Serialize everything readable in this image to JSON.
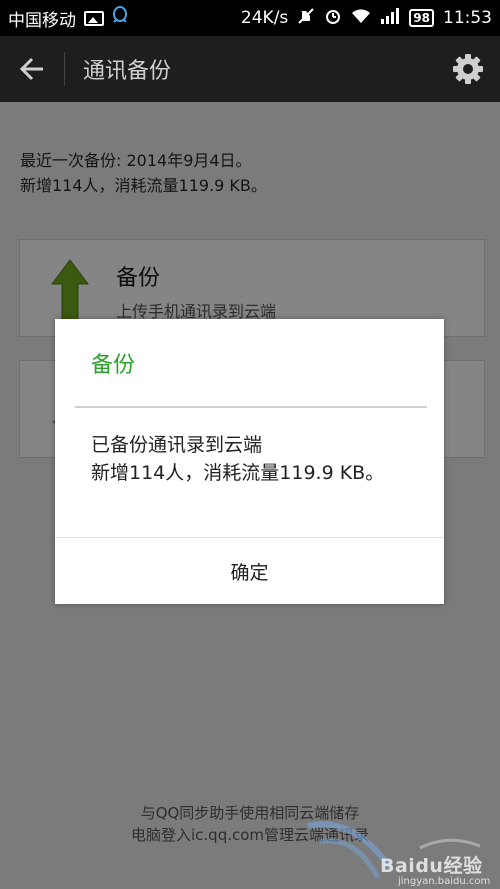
{
  "status_bar": {
    "carrier": "中国移动",
    "speed": "24K/s",
    "battery": "98",
    "time": "11:53"
  },
  "app_bar": {
    "title": "通讯备份"
  },
  "backup_info": {
    "last_backup": "最近一次备份: 2014年9月4日。",
    "summary": "新增114人，消耗流量119.9 KB。"
  },
  "backup_card": {
    "title": "备份",
    "subtitle": "上传手机通讯录到云端"
  },
  "footer": {
    "line1": "与QQ同步助手使用相同云端储存",
    "line2": "电脑登入ic.qq.com管理云端通讯录"
  },
  "dialog": {
    "title": "备份",
    "message": "已备份通讯录到云端\n新增114人，消耗流量119.9 KB。",
    "ok_label": "确定"
  },
  "watermark": {
    "brand": "Baidu经验",
    "url": "jingyan.baidu.com"
  },
  "colors": {
    "accent_green": "#2ea02e",
    "app_bar": "#1e1e1e",
    "dim_overlay": "#7b7b7b"
  }
}
